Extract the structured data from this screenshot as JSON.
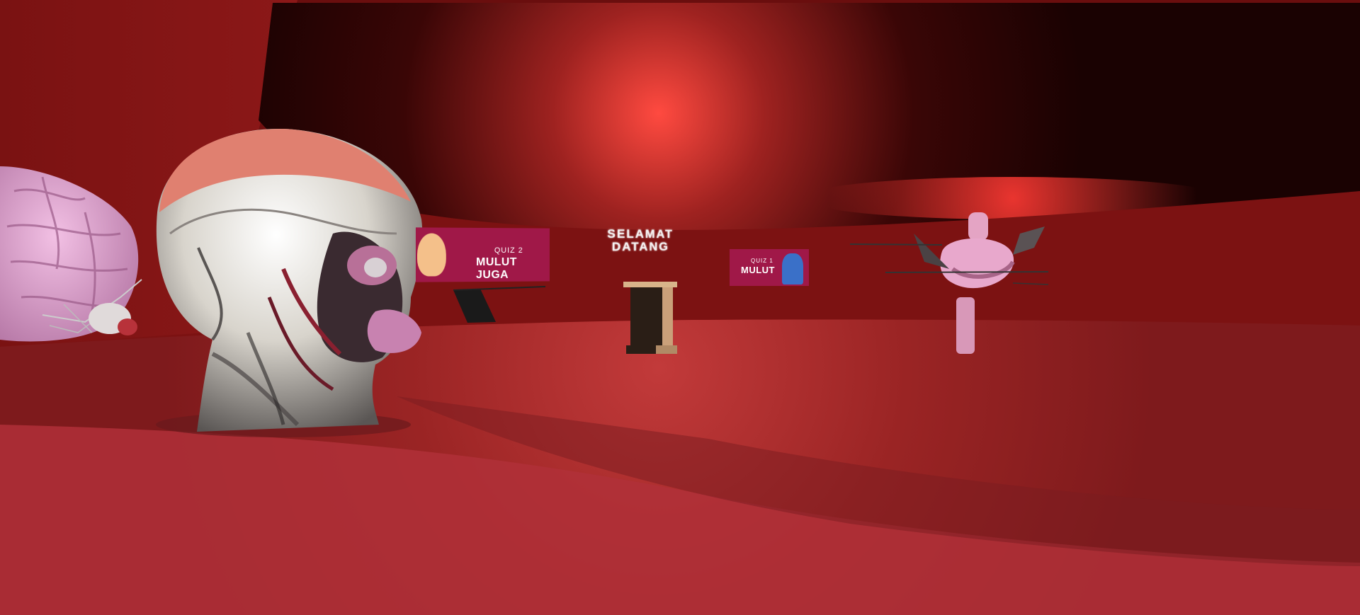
{
  "scene": {
    "welcome_text": "SELAMAT\nDATANG",
    "welcome_line1": "SELAMAT",
    "welcome_line2": "DATANG",
    "banners": [
      {
        "small": "QUIZ 2",
        "big": "MULUT JUGA"
      },
      {
        "small": "QUIZ 1",
        "big": "MULUT"
      }
    ],
    "colors": {
      "wall": "#7a1414",
      "floor": "#b3323a",
      "ceiling_glow": "#ff4a40",
      "banner": "#a01848"
    },
    "objects": [
      "brain-model",
      "head-muscle-model",
      "pedestal",
      "stomach-organ-model",
      "quiz-board-2",
      "quiz-board-1"
    ]
  }
}
